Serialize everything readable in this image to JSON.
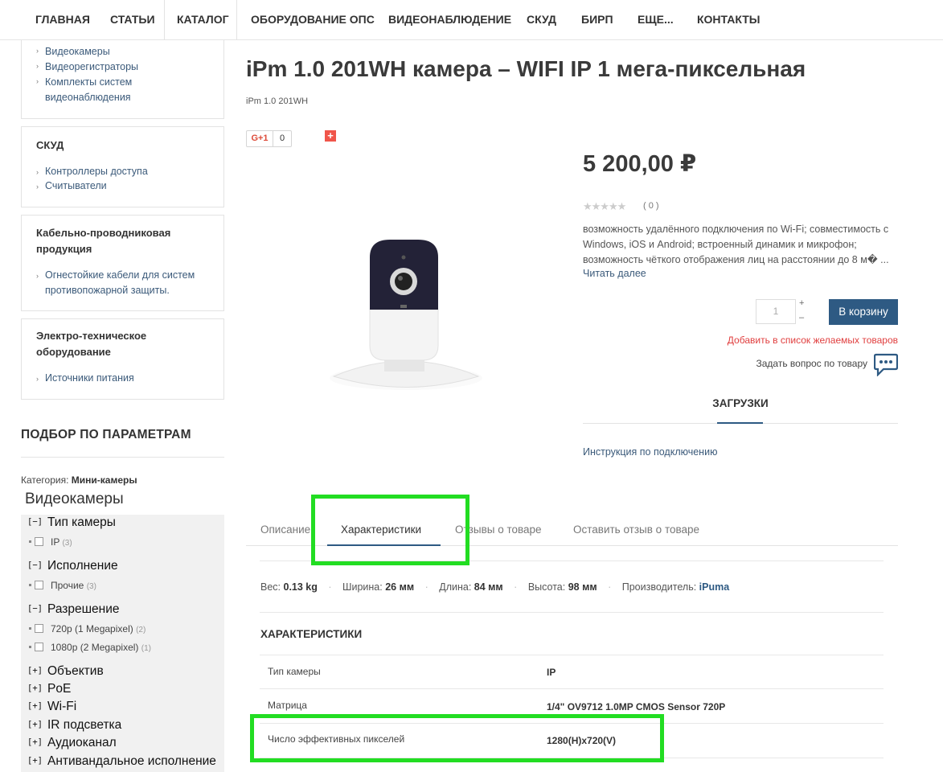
{
  "nav": {
    "items": [
      "ГЛАВНАЯ",
      "СТАТЬИ",
      "КАТАЛОГ",
      "ОБОРУДОВАНИЕ ОПС",
      "ВИДЕОНАБЛЮДЕНИЕ",
      "СКУД",
      "БИРП",
      "ЕЩЕ...",
      "КОНТАКТЫ"
    ]
  },
  "sidebar": {
    "video_links": [
      "Видеокамеры",
      "Видеорегистраторы",
      "Комплекты систем",
      "видеонаблюдения"
    ],
    "skud": {
      "title": "СКУД",
      "links": [
        "Контроллеры доступа",
        "Считыватели"
      ]
    },
    "cable": {
      "title_1": "Кабельно-проводниковая",
      "title_2": "продукция",
      "link_1": "Огнестойкие кабели для систем",
      "link_2": "противопожарной защиты."
    },
    "electro": {
      "title_1": "Электро-техническое",
      "title_2": "оборудование",
      "link": "Источники питания"
    }
  },
  "filter": {
    "heading": "ПОДБОР ПО ПАРАМЕТРАМ",
    "category_label": "Категория:",
    "category_value": "Мини-камеры",
    "section_title": "Видеокамеры",
    "groups": {
      "camera_type": {
        "toggle": "[−]",
        "label": "Тип камеры",
        "option": "IP",
        "count": "(3)"
      },
      "execution": {
        "toggle": "[−]",
        "label": "Исполнение",
        "option": "Прочие",
        "count": "(3)"
      },
      "resolution": {
        "toggle": "[−]",
        "label": "Разрешение",
        "option_1": "720p (1 Megapixel)",
        "count_1": "(2)",
        "option_2": "1080p (2 Megapixel)",
        "count_2": "(1)"
      },
      "lens": {
        "toggle": "[+]",
        "label": "Объектив"
      },
      "poe": {
        "toggle": "[+]",
        "label": "PoE"
      },
      "wifi": {
        "toggle": "[+]",
        "label": "Wi-Fi"
      },
      "ir": {
        "toggle": "[+]",
        "label": "IR подсветка"
      },
      "audio": {
        "toggle": "[+]",
        "label": "Аудиоканал"
      },
      "antivandal": {
        "toggle": "[+]",
        "label": "Антивандальное исполнение"
      }
    }
  },
  "product": {
    "title": "iPm 1.0 201WH камера – WIFI IP 1 мега-пиксельная",
    "sku": "iPm 1.0 201WH",
    "gplus_label": "G+1",
    "gplus_count": "0",
    "share_plus": "+",
    "price": "5 200,00 ₽",
    "stars": "★★★★★",
    "rating_count": "( 0 )",
    "description": "возможность удалённого подключения по Wi-Fi; совместимость с Windows, iOS и Android; встроенный динамик и микрофон; возможность чёткого отображения лиц на расстоянии до 8 м� ...",
    "read_more": "Читать далее",
    "qty_value": "1",
    "qty_plus": "+",
    "qty_minus": "–",
    "cart_button": "В корзину",
    "wishlist": "Добавить в список желаемых товаров",
    "ask_question": "Задать вопрос по товару",
    "downloads_heading": "ЗАГРУЗКИ",
    "download_link": "Инструкция по подключению"
  },
  "tabs": [
    "Описание",
    "Характеристики",
    "Отзывы о товаре",
    "Оставить отзыв о товаре"
  ],
  "attributes": {
    "weight_label": "Вес:",
    "weight": "0.13 kg",
    "width_label": "Ширина:",
    "width": "26 мм",
    "length_label": "Длина:",
    "length": "84 мм",
    "height_label": "Высота:",
    "height": "98 мм",
    "maker_label": "Производитель:",
    "maker": "iPuma"
  },
  "specs": {
    "heading": "ХАРАКТЕРИСТИКИ",
    "rows": [
      {
        "key": "Тип камеры",
        "value": "IP"
      },
      {
        "key": "Матрица",
        "value": "1/4\" OV9712 1.0MP CMOS Sensor 720P"
      },
      {
        "key": "Число эффективных пикселей",
        "value": "1280(H)x720(V)"
      }
    ]
  },
  "colors": {
    "accent": "#2e5a83",
    "highlight": "#22dd22",
    "wishlist": "#e03e3e"
  }
}
